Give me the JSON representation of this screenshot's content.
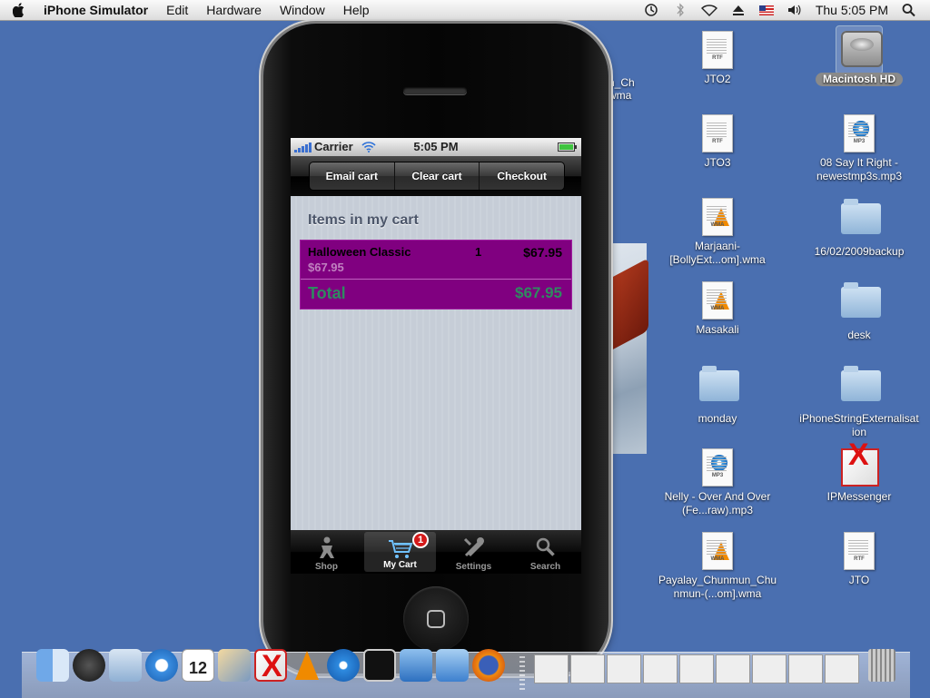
{
  "menubar": {
    "app_name": "iPhone Simulator",
    "menus": [
      "Edit",
      "Hardware",
      "Window",
      "Help"
    ],
    "clock": "Thu 5:05 PM"
  },
  "phone": {
    "status": {
      "carrier": "Carrier",
      "time": "5:05 PM"
    },
    "toolbar": [
      "Email cart",
      "Clear cart",
      "Checkout"
    ],
    "cart": {
      "header": "Items in my cart",
      "item": {
        "name": "Halloween Classic",
        "qty": "1",
        "price": "$67.95",
        "unit_price": "$67.95"
      },
      "total_label": "Total",
      "total_value": "$67.95"
    },
    "tabs": [
      {
        "label": "Shop",
        "icon": "shop-icon"
      },
      {
        "label": "My Cart",
        "icon": "cart-icon",
        "badge": "1",
        "active": true
      },
      {
        "label": "Settings",
        "icon": "settings-icon"
      },
      {
        "label": "Search",
        "icon": "search-icon"
      }
    ]
  },
  "desktop": {
    "partial_label": [
      "n_Ch",
      "wma"
    ],
    "icons": [
      {
        "label": "Macintosh HD",
        "type": "hd"
      },
      {
        "label": "JTO2",
        "type": "rtf"
      },
      {
        "label": "JTO3",
        "type": "rtf"
      },
      {
        "label": "08 Say It Right - newestmp3s.mp3",
        "type": "mp3"
      },
      {
        "label": "Marjaani-[BollyExt...om].wma",
        "type": "wma"
      },
      {
        "label": "16/02/2009backup",
        "type": "folder"
      },
      {
        "label": "Masakali",
        "type": "wma"
      },
      {
        "label": "desk",
        "type": "folder"
      },
      {
        "label": "monday",
        "type": "folder"
      },
      {
        "label": "iPhoneStringExternalisation",
        "type": "folder"
      },
      {
        "label": "Nelly - Over And Over (Fe...raw).mp3",
        "type": "mp3"
      },
      {
        "label": "IPMessenger",
        "type": "app"
      },
      {
        "label": "Payalay_Chunmun_Chunmun-(...om].wma",
        "type": "wma"
      },
      {
        "label": "JTO",
        "type": "rtf"
      }
    ],
    "file_tags": {
      "rtf": "RTF",
      "mp3": "MP3",
      "wma": "WMA"
    }
  },
  "dock": {
    "calendar_day": "12"
  },
  "colors": {
    "desktop": "#4a6fb0",
    "cart_row": "#800080",
    "total_text": "#2f8a60",
    "badge": "#d41a1a"
  }
}
